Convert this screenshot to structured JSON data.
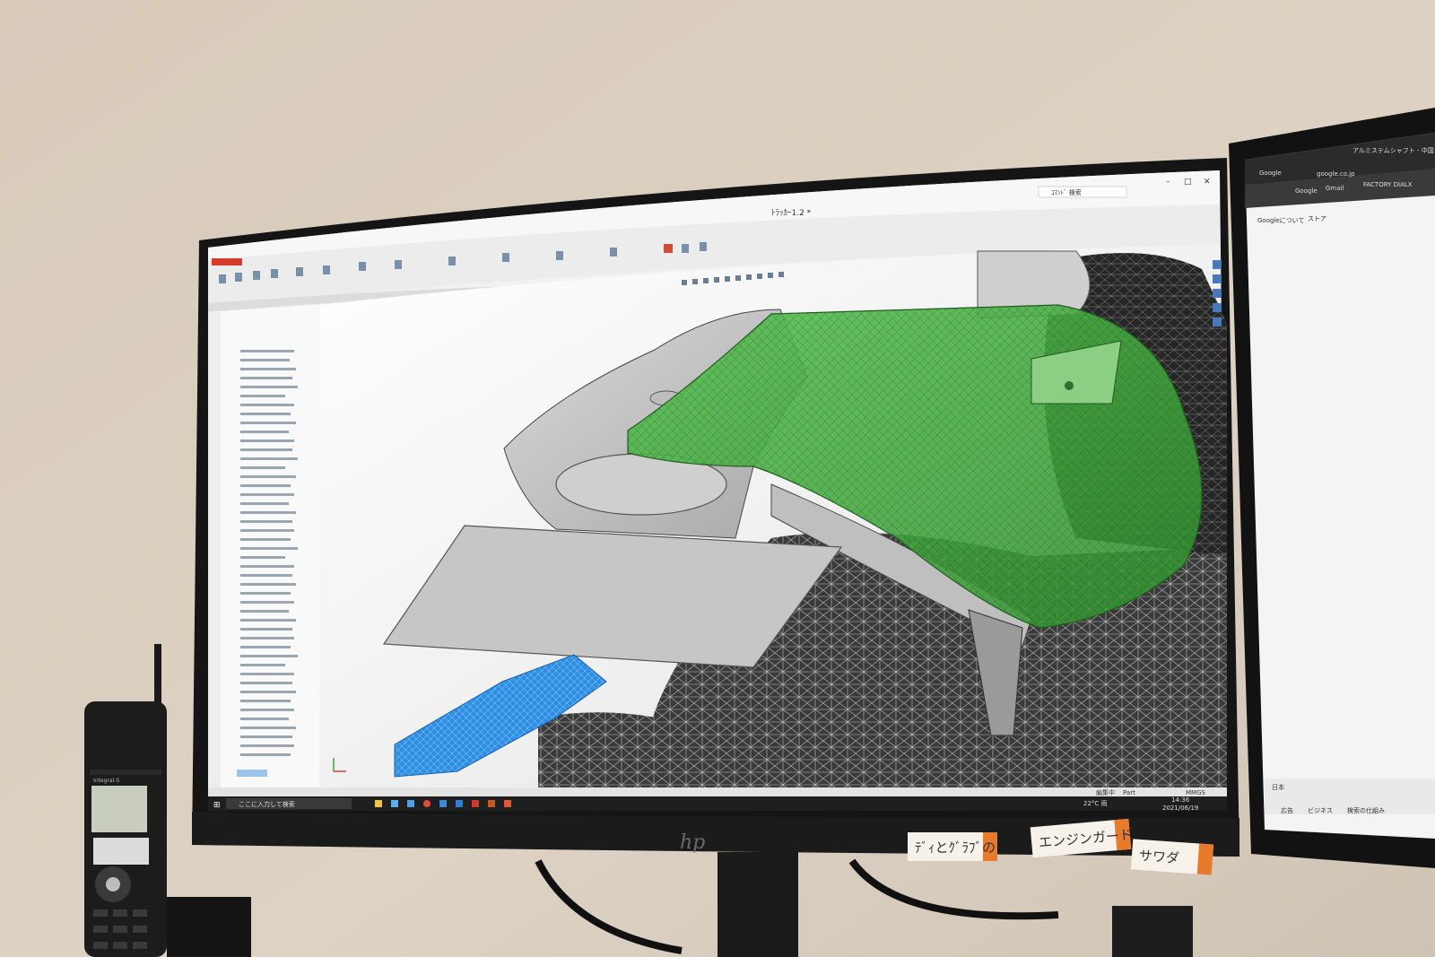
{
  "monitor": {
    "brand_logo": "hp",
    "window_title": "ﾄﾗｯｶｰ1.2 *",
    "search_placeholder": "ｺﾏﾝﾄﾞ 検索",
    "status_editing": "編集中",
    "status_part": "Part",
    "status_units": "MMGS",
    "taskbar_search": "ここに入力して検索",
    "weather": "22°C 雨",
    "clock_time": "14:36",
    "clock_date": "2021/06/19"
  },
  "side_monitor": {
    "tab_google": "Google",
    "tab_other": "アルミステムシャフト - 中国",
    "address": "google.co.jp",
    "bookmark_google": "Google",
    "bookmark_gmail": "Gmail",
    "bookmark_factory": "FACTORY DIALX",
    "page_link_about": "Googleについて",
    "page_link_store": "ストア",
    "footer_country": "日本",
    "footer_ads": "広告",
    "footer_business": "ビジネス",
    "footer_how": "検索の仕組み"
  },
  "notes": {
    "note1": "ﾃﾞｨとｸﾞﾗﾌﾞの",
    "note2": "エンジンガード",
    "note3": "サワダ"
  },
  "phone": {
    "label": "Integral-S"
  },
  "colors": {
    "wall": "#d9cdbf",
    "bezel": "#151515",
    "green_part": "#3fae3a",
    "blue_part": "#2f8fe6",
    "note_orange": "#e87a2c"
  }
}
